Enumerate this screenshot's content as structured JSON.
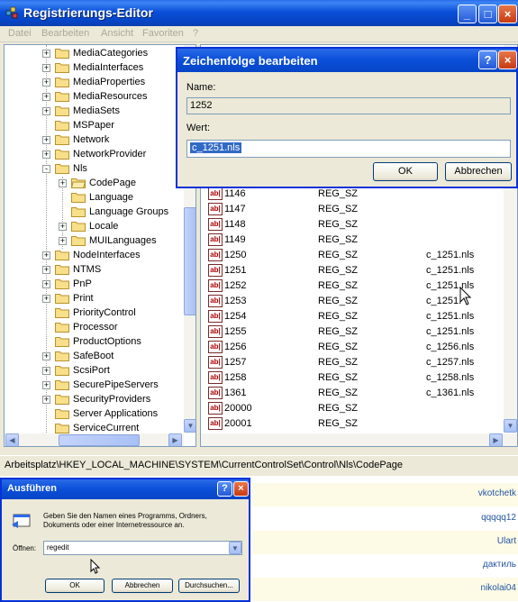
{
  "window": {
    "title": "Registrierungs-Editor",
    "menu": [
      "Datei",
      "Bearbeiten",
      "Ansicht",
      "Favoriten",
      "?"
    ],
    "buttons": {
      "minimize": "_",
      "maximize": "□",
      "close": "×"
    }
  },
  "tree": {
    "items": [
      {
        "label": "MediaCategories",
        "expand": "+",
        "indent": 0
      },
      {
        "label": "MediaInterfaces",
        "expand": "+",
        "indent": 0
      },
      {
        "label": "MediaProperties",
        "expand": "+",
        "indent": 0
      },
      {
        "label": "MediaResources",
        "expand": "+",
        "indent": 0
      },
      {
        "label": "MediaSets",
        "expand": "+",
        "indent": 0
      },
      {
        "label": "MSPaper",
        "expand": "",
        "indent": 0
      },
      {
        "label": "Network",
        "expand": "+",
        "indent": 0
      },
      {
        "label": "NetworkProvider",
        "expand": "+",
        "indent": 0
      },
      {
        "label": "Nls",
        "expand": "-",
        "indent": 0
      },
      {
        "label": "CodePage",
        "expand": "+",
        "indent": 1
      },
      {
        "label": "Language",
        "expand": "",
        "indent": 1
      },
      {
        "label": "Language Groups",
        "expand": "",
        "indent": 1
      },
      {
        "label": "Locale",
        "expand": "+",
        "indent": 1
      },
      {
        "label": "MUILanguages",
        "expand": "+",
        "indent": 1
      },
      {
        "label": "NodeInterfaces",
        "expand": "+",
        "indent": 0
      },
      {
        "label": "NTMS",
        "expand": "+",
        "indent": 0
      },
      {
        "label": "PnP",
        "expand": "+",
        "indent": 0
      },
      {
        "label": "Print",
        "expand": "+",
        "indent": 0
      },
      {
        "label": "PriorityControl",
        "expand": "",
        "indent": 0
      },
      {
        "label": "Processor",
        "expand": "",
        "indent": 0
      },
      {
        "label": "ProductOptions",
        "expand": "",
        "indent": 0
      },
      {
        "label": "SafeBoot",
        "expand": "+",
        "indent": 0
      },
      {
        "label": "ScsiPort",
        "expand": "+",
        "indent": 0
      },
      {
        "label": "SecurePipeServers",
        "expand": "+",
        "indent": 0
      },
      {
        "label": "SecurityProviders",
        "expand": "+",
        "indent": 0
      },
      {
        "label": "Server Applications",
        "expand": "",
        "indent": 0
      },
      {
        "label": "ServiceCurrent",
        "expand": "",
        "indent": 0
      }
    ]
  },
  "list": {
    "icon": "ab|",
    "rows": [
      {
        "name": "1146",
        "type": "REG_SZ",
        "value": ""
      },
      {
        "name": "1147",
        "type": "REG_SZ",
        "value": ""
      },
      {
        "name": "1148",
        "type": "REG_SZ",
        "value": ""
      },
      {
        "name": "1149",
        "type": "REG_SZ",
        "value": ""
      },
      {
        "name": "1250",
        "type": "REG_SZ",
        "value": "c_1251.nls"
      },
      {
        "name": "1251",
        "type": "REG_SZ",
        "value": "c_1251.nls"
      },
      {
        "name": "1252",
        "type": "REG_SZ",
        "value": "c_1251.nls"
      },
      {
        "name": "1253",
        "type": "REG_SZ",
        "value": "c_1251."
      },
      {
        "name": "1254",
        "type": "REG_SZ",
        "value": "c_1251.nls"
      },
      {
        "name": "1255",
        "type": "REG_SZ",
        "value": "c_1251.nls"
      },
      {
        "name": "1256",
        "type": "REG_SZ",
        "value": "c_1256.nls"
      },
      {
        "name": "1257",
        "type": "REG_SZ",
        "value": "c_1257.nls"
      },
      {
        "name": "1258",
        "type": "REG_SZ",
        "value": "c_1258.nls"
      },
      {
        "name": "1361",
        "type": "REG_SZ",
        "value": "c_1361.nls"
      },
      {
        "name": "20000",
        "type": "REG_SZ",
        "value": ""
      },
      {
        "name": "20001",
        "type": "REG_SZ",
        "value": ""
      }
    ]
  },
  "status": "Arbeitsplatz\\HKEY_LOCAL_MACHINE\\SYSTEM\\CurrentControlSet\\Control\\Nls\\CodePage",
  "edit_dialog": {
    "title": "Zeichenfolge bearbeiten",
    "name_label": "Name:",
    "name_value": "1252",
    "value_label": "Wert:",
    "value_value": "c_1251.nls",
    "ok": "OK",
    "cancel": "Abbrechen",
    "help": "?",
    "close": "×"
  },
  "run_dialog": {
    "title": "Ausführen",
    "description": "Geben Sie den Namen eines Programms, Ordners, Dokuments oder einer Internetressource an.",
    "open_label": "Öffnen:",
    "open_value": "regedit",
    "ok": "OK",
    "cancel": "Abbrechen",
    "browse": "Durchsuchen...",
    "help": "?",
    "close": "×"
  },
  "background_page": {
    "users": [
      "vkotchetk",
      "qqqqq12",
      "Ulart",
      "дактиль",
      "nikolai04"
    ]
  },
  "colors": {
    "title_blue": "#0a4fd8",
    "link_blue": "#2255a4",
    "selection": "#316ac5"
  }
}
